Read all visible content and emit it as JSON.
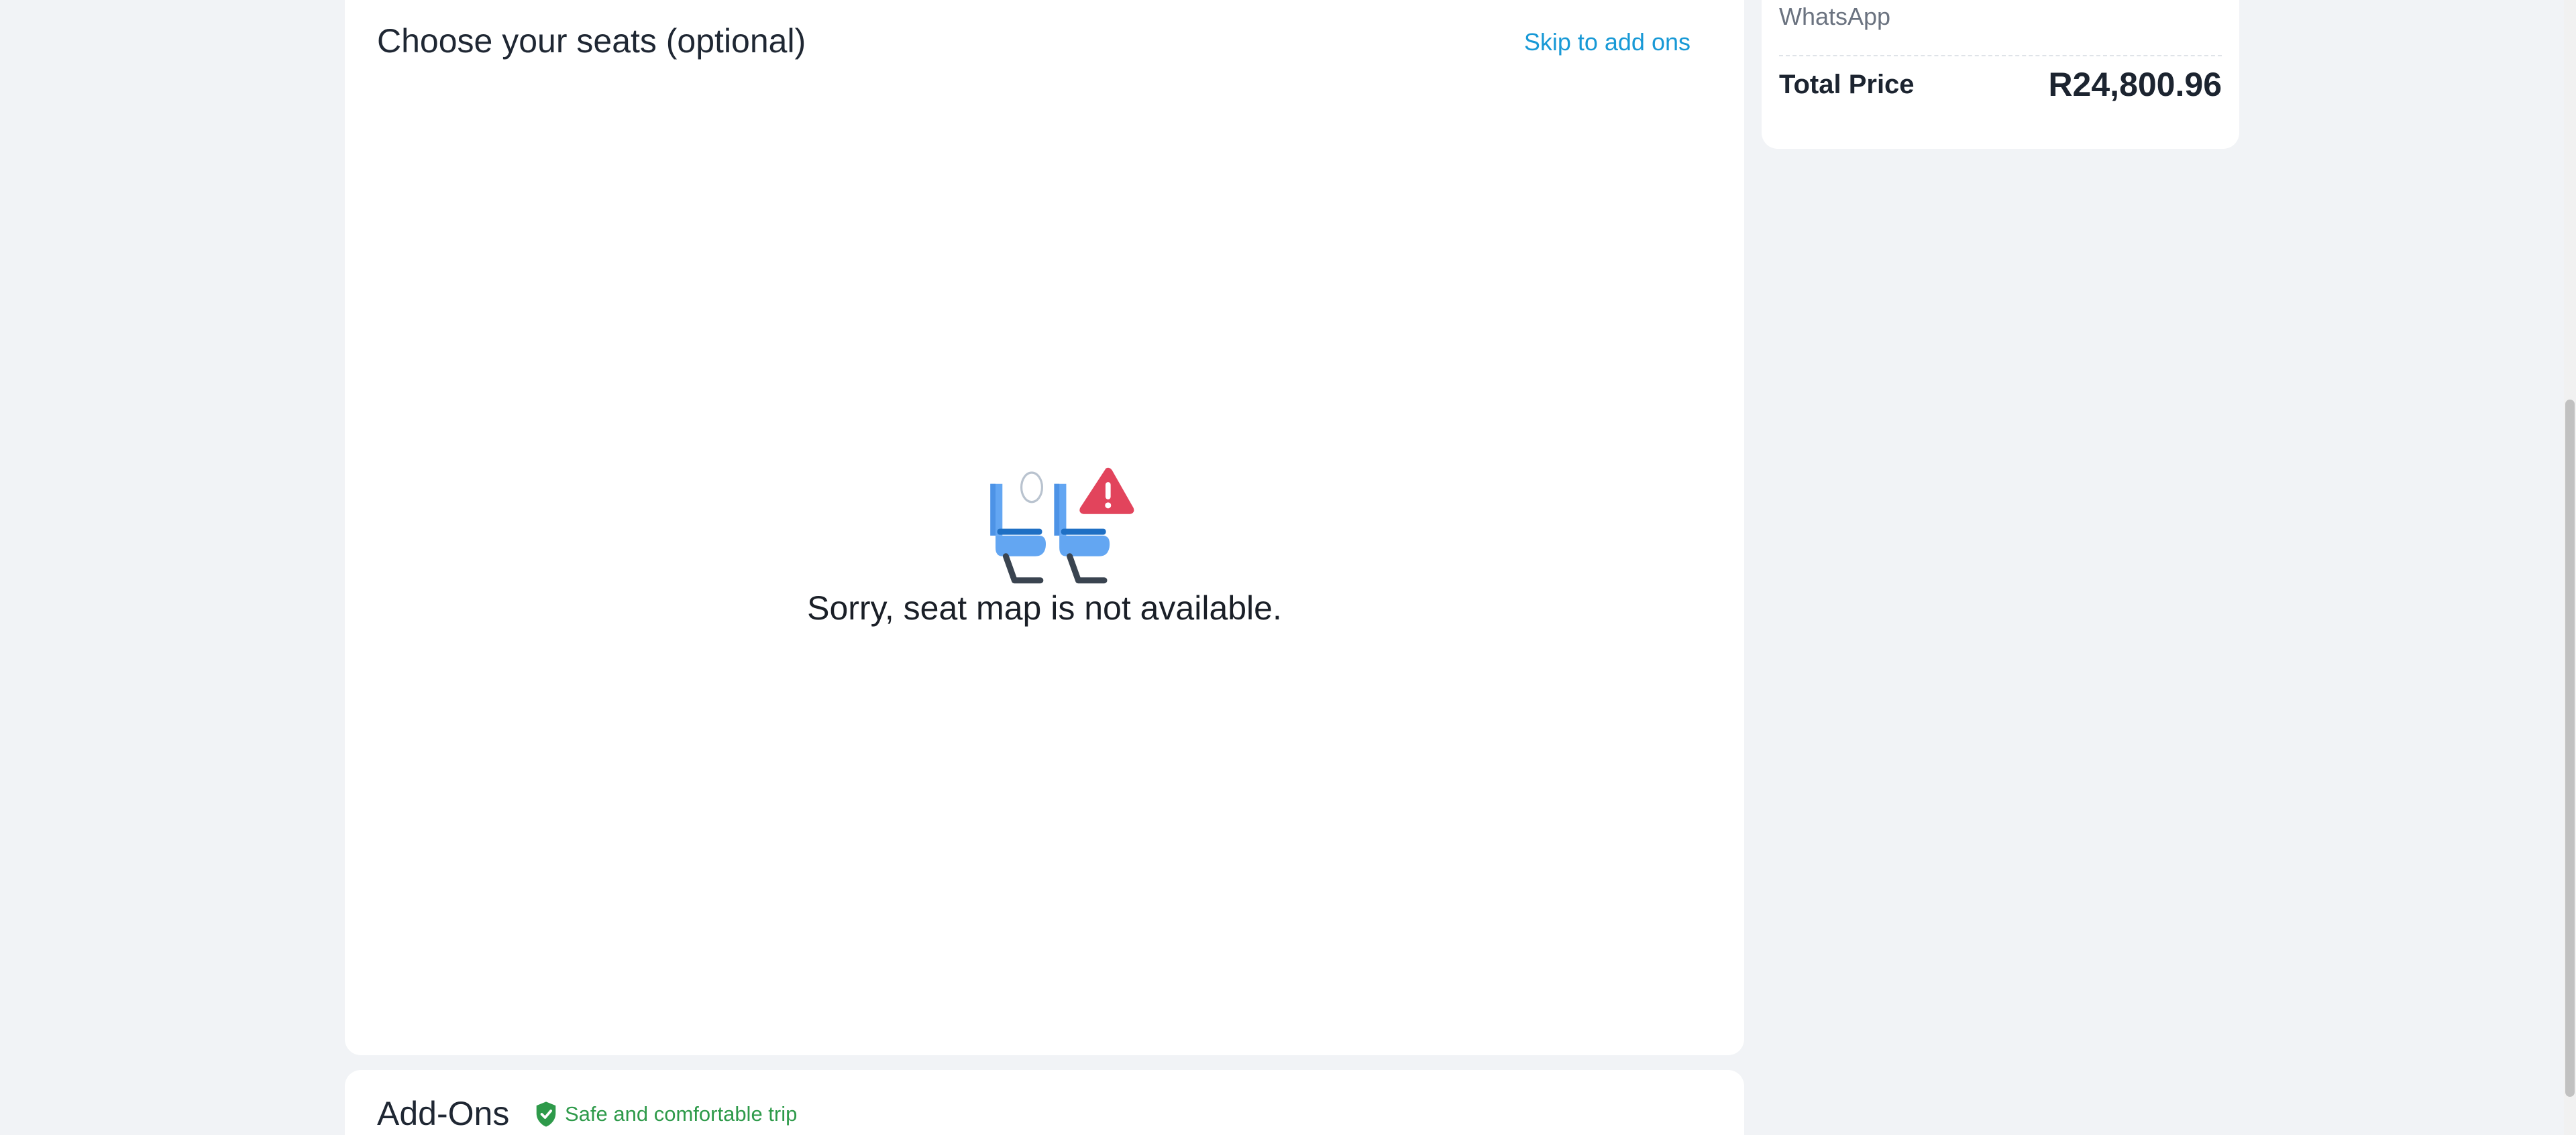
{
  "seat_selection": {
    "title": "Choose your seats (optional)",
    "skip_link": "Skip to add ons",
    "unavailable_message": "Sorry, seat map is not available.",
    "illustration_icon": "seat-unavailable-icon"
  },
  "price_summary": {
    "contact_method": "WhatsApp",
    "total_label": "Total Price",
    "total_value": "R24,800.96"
  },
  "add_ons": {
    "title": "Add-Ons",
    "badge_text": "Safe and comfortable trip",
    "badge_icon": "shield-check-icon"
  },
  "colors": {
    "link": "#1899d6",
    "badge_green": "#2e9a4a",
    "seat_blue": "#63a6f2",
    "warning_red": "#e2445c",
    "background": "#f1f3f6"
  }
}
